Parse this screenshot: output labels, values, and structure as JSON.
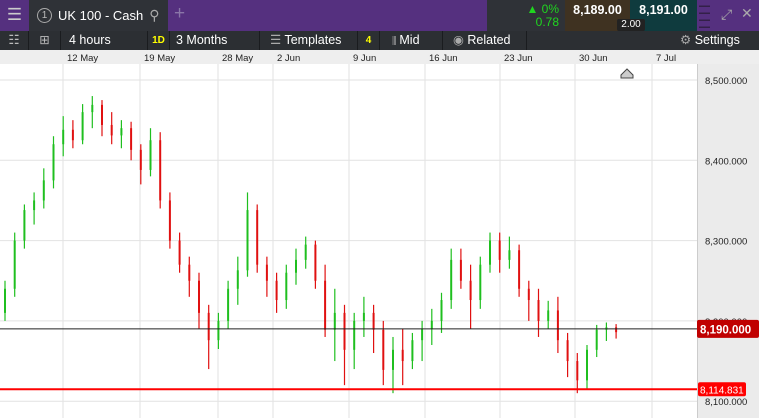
{
  "header": {
    "menu_icon": "hamburger-icon",
    "tab_number": "1",
    "instrument": "UK 100 - Cash",
    "change_pct": "▲ 0%",
    "change_abs": "0.78",
    "sell_price": "8,189.00",
    "buy_price": "8,191.00",
    "spread": "2.00",
    "colors": {
      "brand": "#55307f",
      "up": "#1fd61f",
      "sell_bg": "#3f3221",
      "buy_bg": "#0f3b3e"
    }
  },
  "toolbar": {
    "interval": "4 hours",
    "range_badge": "1D",
    "range": "3 Months",
    "templates": "Templates",
    "templates_count": "4",
    "price_type": "Mid",
    "related": "Related",
    "settings": "Settings"
  },
  "chart_data": {
    "type": "candlestick",
    "x_tick_labels": [
      "12 May",
      "19 May",
      "28 May",
      "2 Jun",
      "9 Jun",
      "16 Jun",
      "23 Jun",
      "30 Jun",
      "7 Jul"
    ],
    "y_tick_labels": [
      "8,500.000",
      "8,400.000",
      "8,300.000",
      "8,200.000",
      "8,100.000"
    ],
    "y_ticks": [
      8500,
      8400,
      8300,
      8200,
      8100
    ],
    "ylim": [
      8090,
      8520
    ],
    "grid": true,
    "colors": {
      "up": "#1fbf1f",
      "down": "#e01010",
      "last_line": "#222222",
      "last_label": "#c00000",
      "level_line": "#ff0000"
    },
    "last_price": 8190,
    "last_price_label": "8,190.000",
    "level": 8114.831,
    "level_label": "8,114.831",
    "candles_ohlc": [
      [
        8210,
        8250,
        8200,
        8240
      ],
      [
        8240,
        8310,
        8230,
        8300
      ],
      [
        8300,
        8345,
        8290,
        8338
      ],
      [
        8338,
        8360,
        8320,
        8350
      ],
      [
        8350,
        8390,
        8340,
        8375
      ],
      [
        8375,
        8430,
        8365,
        8420
      ],
      [
        8420,
        8455,
        8405,
        8438
      ],
      [
        8438,
        8450,
        8415,
        8425
      ],
      [
        8425,
        8470,
        8420,
        8460
      ],
      [
        8460,
        8480,
        8440,
        8469
      ],
      [
        8469,
        8475,
        8430,
        8444
      ],
      [
        8444,
        8460,
        8420,
        8431
      ],
      [
        8431,
        8450,
        8415,
        8440
      ],
      [
        8440,
        8448,
        8400,
        8413
      ],
      [
        8413,
        8420,
        8370,
        8388
      ],
      [
        8388,
        8440,
        8380,
        8425
      ],
      [
        8425,
        8435,
        8340,
        8350
      ],
      [
        8350,
        8360,
        8290,
        8300
      ],
      [
        8300,
        8310,
        8260,
        8270
      ],
      [
        8270,
        8280,
        8230,
        8250
      ],
      [
        8250,
        8260,
        8190,
        8210
      ],
      [
        8210,
        8220,
        8140,
        8176
      ],
      [
        8176,
        8210,
        8165,
        8200
      ],
      [
        8200,
        8250,
        8190,
        8240
      ],
      [
        8240,
        8280,
        8220,
        8263
      ],
      [
        8263,
        8360,
        8255,
        8338
      ],
      [
        8338,
        8345,
        8260,
        8270
      ],
      [
        8270,
        8280,
        8230,
        8250
      ],
      [
        8250,
        8260,
        8210,
        8226
      ],
      [
        8226,
        8270,
        8215,
        8260
      ],
      [
        8260,
        8290,
        8245,
        8276
      ],
      [
        8276,
        8305,
        8265,
        8295
      ],
      [
        8295,
        8300,
        8240,
        8250
      ],
      [
        8250,
        8270,
        8180,
        8189
      ],
      [
        8189,
        8240,
        8150,
        8210
      ],
      [
        8210,
        8220,
        8120,
        8164
      ],
      [
        8164,
        8210,
        8140,
        8200
      ],
      [
        8200,
        8230,
        8180,
        8210
      ],
      [
        8210,
        8220,
        8160,
        8189
      ],
      [
        8189,
        8200,
        8120,
        8139
      ],
      [
        8139,
        8180,
        8110,
        8164
      ],
      [
        8164,
        8190,
        8120,
        8150
      ],
      [
        8150,
        8185,
        8140,
        8176
      ],
      [
        8176,
        8200,
        8150,
        8190
      ],
      [
        8190,
        8215,
        8170,
        8200
      ],
      [
        8200,
        8235,
        8185,
        8226
      ],
      [
        8226,
        8290,
        8215,
        8276
      ],
      [
        8276,
        8290,
        8240,
        8250
      ],
      [
        8250,
        8270,
        8190,
        8226
      ],
      [
        8226,
        8280,
        8215,
        8270
      ],
      [
        8270,
        8310,
        8260,
        8300
      ],
      [
        8300,
        8310,
        8260,
        8276
      ],
      [
        8276,
        8305,
        8265,
        8288
      ],
      [
        8288,
        8295,
        8230,
        8240
      ],
      [
        8240,
        8250,
        8200,
        8226
      ],
      [
        8226,
        8240,
        8180,
        8200
      ],
      [
        8200,
        8225,
        8190,
        8213
      ],
      [
        8213,
        8230,
        8160,
        8176
      ],
      [
        8176,
        8185,
        8130,
        8150
      ],
      [
        8150,
        8160,
        8110,
        8126
      ],
      [
        8126,
        8170,
        8115,
        8164
      ],
      [
        8164,
        8195,
        8155,
        8189
      ],
      [
        8189,
        8198,
        8175,
        8192
      ],
      [
        8192,
        8196,
        8178,
        8186
      ]
    ]
  }
}
